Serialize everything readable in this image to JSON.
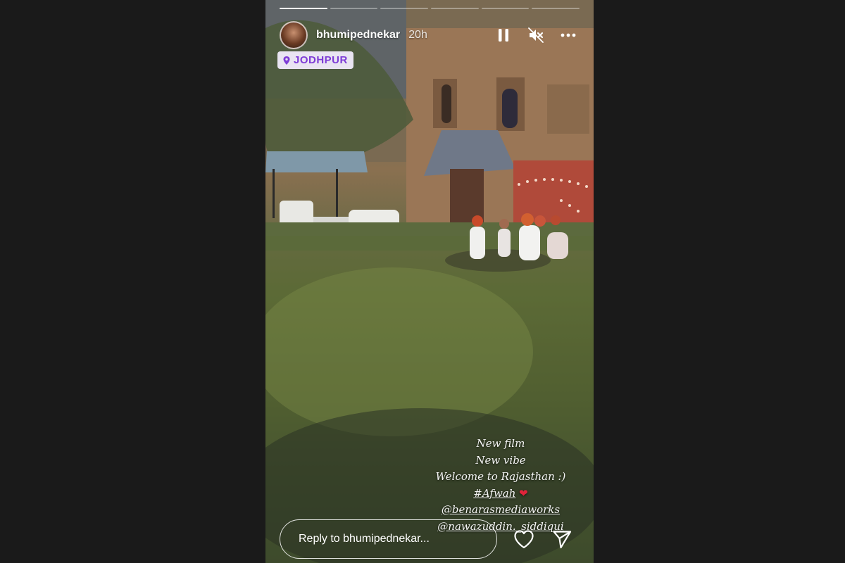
{
  "story": {
    "username": "bhumipednekar",
    "time_ago": "20h",
    "progress_segments": 6,
    "active_segment": 1,
    "location": "JODHPUR",
    "caption": {
      "line1": "New film",
      "line2": "New vibe",
      "line3": "Welcome to Rajasthan :)",
      "hashtag": "#Afwah",
      "heart": "❤",
      "mention1": "@benarasmediaworks",
      "mention2": "@nawazuddin._siddiqui"
    },
    "reply_placeholder": "Reply to bhumipednekar...",
    "icons": {
      "pause": "pause-icon",
      "mute": "muted-speaker-icon",
      "more": "more-options-icon",
      "like": "heart-icon",
      "share": "send-icon",
      "location": "location-pin-icon"
    },
    "colors": {
      "location_text": "#7d3bd6",
      "location_bg": "#e9e4f2",
      "heart": "#e0243a"
    }
  }
}
